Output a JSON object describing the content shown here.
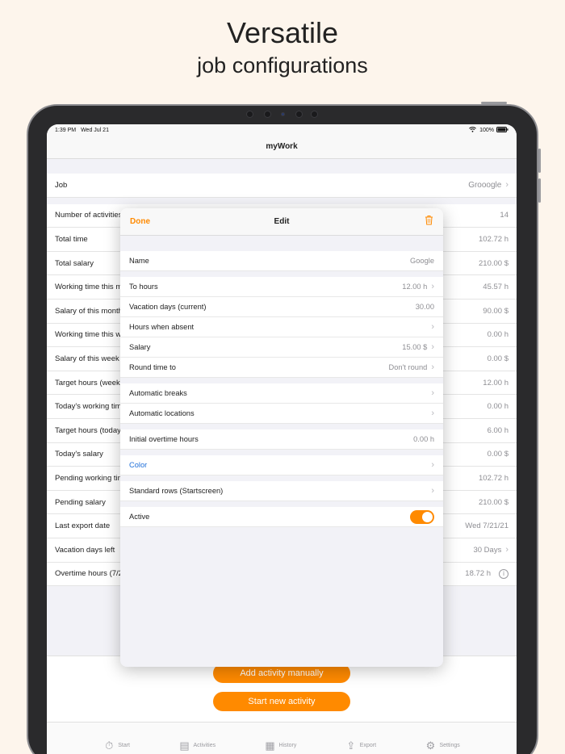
{
  "headline": {
    "line1": "Versatile",
    "line2": "job configurations"
  },
  "status": {
    "time": "1:39 PM",
    "date": "Wed Jul 21",
    "battery": "100%"
  },
  "nav": {
    "title": "myWork"
  },
  "job_row": {
    "label": "Job",
    "value": "Grooogle"
  },
  "rows": [
    {
      "label": "Number of activities",
      "value": "14"
    },
    {
      "label": "Total time",
      "value": "102.72 h"
    },
    {
      "label": "Total salary",
      "value": "210.00 $"
    },
    {
      "label": "Working time this month",
      "value": "45.57 h"
    },
    {
      "label": "Salary of this month",
      "value": "90.00 $"
    },
    {
      "label": "Working time this week",
      "value": "0.00 h"
    },
    {
      "label": "Salary of this week",
      "value": "0.00 $"
    },
    {
      "label": "Target hours (week)",
      "value": "12.00 h"
    },
    {
      "label": "Today's working time",
      "value": "0.00 h"
    },
    {
      "label": "Target hours (today)",
      "value": "6.00 h"
    },
    {
      "label": "Today's salary",
      "value": "0.00 $"
    },
    {
      "label": "Pending working time",
      "value": "102.72 h"
    },
    {
      "label": "Pending salary",
      "value": "210.00 $"
    },
    {
      "label": "Last export date",
      "value": "Wed 7/21/21"
    },
    {
      "label": "Vacation days left",
      "value": "30 Days"
    },
    {
      "label": "Overtime hours (7/21)",
      "value": "18.72 h"
    }
  ],
  "buttons": {
    "add_manual": "Add activity manually",
    "start_new": "Start new activity"
  },
  "tabs": [
    {
      "label": "Start",
      "icon": "stopwatch-icon"
    },
    {
      "label": "Activities",
      "icon": "activities-icon"
    },
    {
      "label": "History",
      "icon": "calendar-icon"
    },
    {
      "label": "Export",
      "icon": "export-icon"
    },
    {
      "label": "Settings",
      "icon": "gear-icon"
    }
  ],
  "modal": {
    "done": "Done",
    "title": "Edit",
    "name": {
      "label": "Name",
      "value": "Google"
    },
    "to_hours": {
      "label": "To hours",
      "value": "12.00 h"
    },
    "vacation": {
      "label": "Vacation days (current)",
      "value": "30.00"
    },
    "absent": {
      "label": "Hours when absent",
      "value": ""
    },
    "salary": {
      "label": "Salary",
      "value": "15.00 $"
    },
    "round": {
      "label": "Round time to",
      "value": "Don't round"
    },
    "breaks": {
      "label": "Automatic breaks"
    },
    "locations": {
      "label": "Automatic locations"
    },
    "overtime": {
      "label": "Initial overtime hours",
      "value": "0.00 h"
    },
    "color": {
      "label": "Color"
    },
    "standard_rows": {
      "label": "Standard rows (Startscreen)"
    },
    "active": {
      "label": "Active",
      "on": true
    }
  },
  "colors": {
    "accent": "#ff8a00",
    "link": "#1f6fd9",
    "background": "#fdf5ec"
  }
}
